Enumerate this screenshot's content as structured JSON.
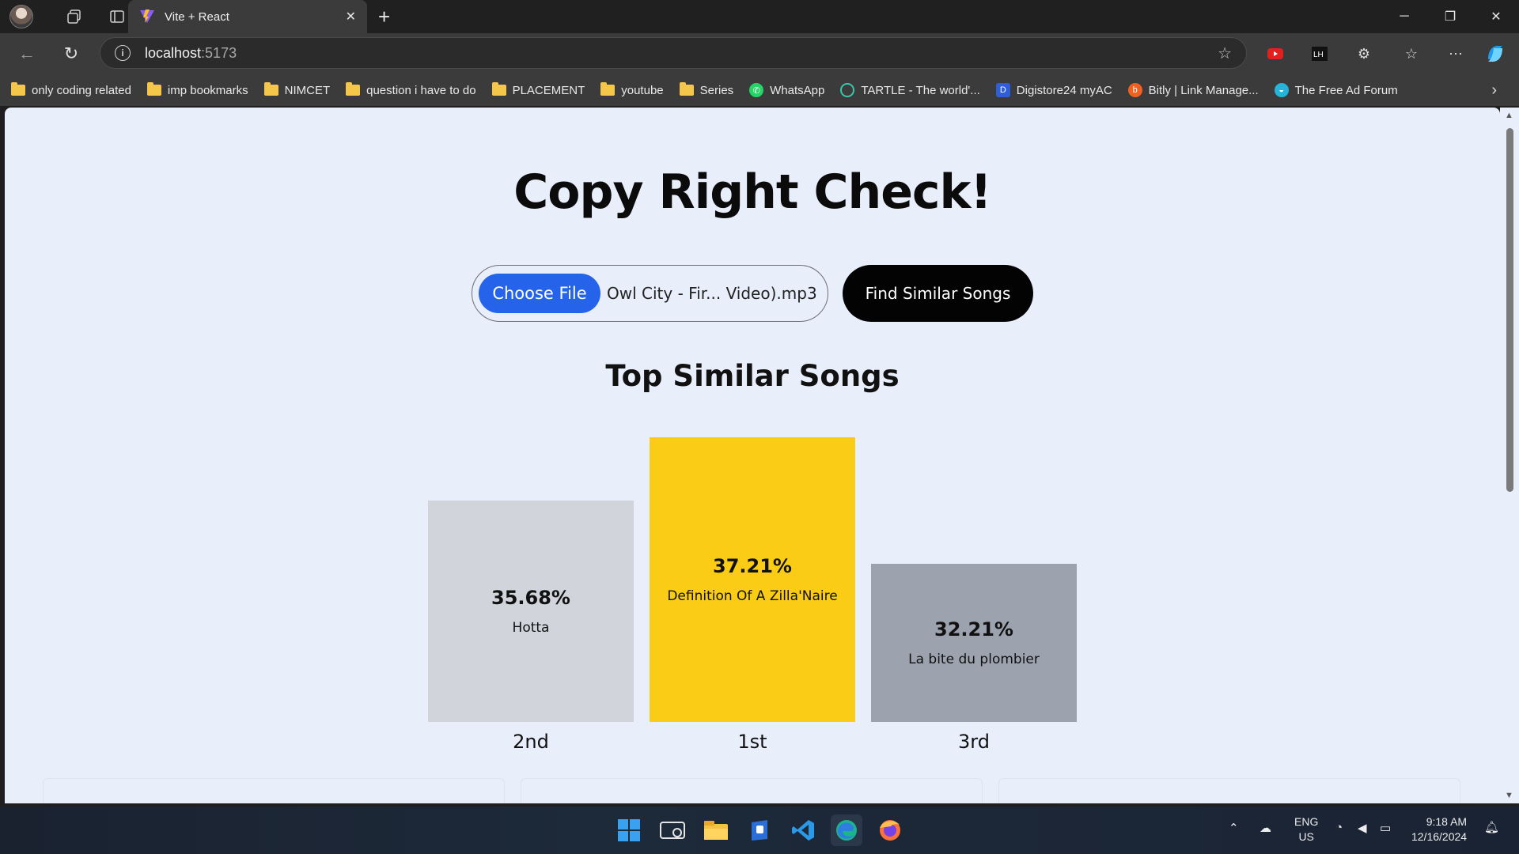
{
  "browser": {
    "tab_title": "Vite + React",
    "url_host": "localhost",
    "url_port": ":5173",
    "bookmarks": [
      {
        "label": "only coding  related",
        "type": "folder"
      },
      {
        "label": "imp bookmarks",
        "type": "folder"
      },
      {
        "label": "NIMCET",
        "type": "folder"
      },
      {
        "label": "question i have to do",
        "type": "folder"
      },
      {
        "label": "PLACEMENT",
        "type": "folder"
      },
      {
        "label": "youtube",
        "type": "folder"
      },
      {
        "label": "Series",
        "type": "folder"
      },
      {
        "label": "WhatsApp",
        "type": "site",
        "icon": "whatsapp-icon"
      },
      {
        "label": "TARTLE - The world'...",
        "type": "site",
        "icon": "tartle-icon"
      },
      {
        "label": "Digistore24 myAC",
        "type": "site",
        "icon": "digistore-icon"
      },
      {
        "label": "Bitly | Link Manage...",
        "type": "site",
        "icon": "bitly-icon"
      },
      {
        "label": "The Free Ad Forum",
        "type": "site",
        "icon": "forum-icon"
      }
    ]
  },
  "page": {
    "title": "Copy Right Check!",
    "choose_file_label": "Choose File",
    "file_name": "Owl City - Fir... Video).mp3",
    "find_button": "Find Similar Songs",
    "section_title": "Top Similar Songs",
    "podium": [
      {
        "rank": "2nd",
        "percent": "35.68%",
        "song": "Hotta",
        "color": "#d1d5db",
        "value": 35.68
      },
      {
        "rank": "1st",
        "percent": "37.21%",
        "song": "Definition Of A Zilla'Naire",
        "color": "#facc15",
        "value": 37.21
      },
      {
        "rank": "3rd",
        "percent": "32.21%",
        "song": "La bite du plombier",
        "color": "#9ca3af",
        "value": 32.21
      }
    ]
  },
  "taskbar": {
    "lang": "ENG",
    "region": "US",
    "time": "9:18 AM",
    "date": "12/16/2024"
  }
}
